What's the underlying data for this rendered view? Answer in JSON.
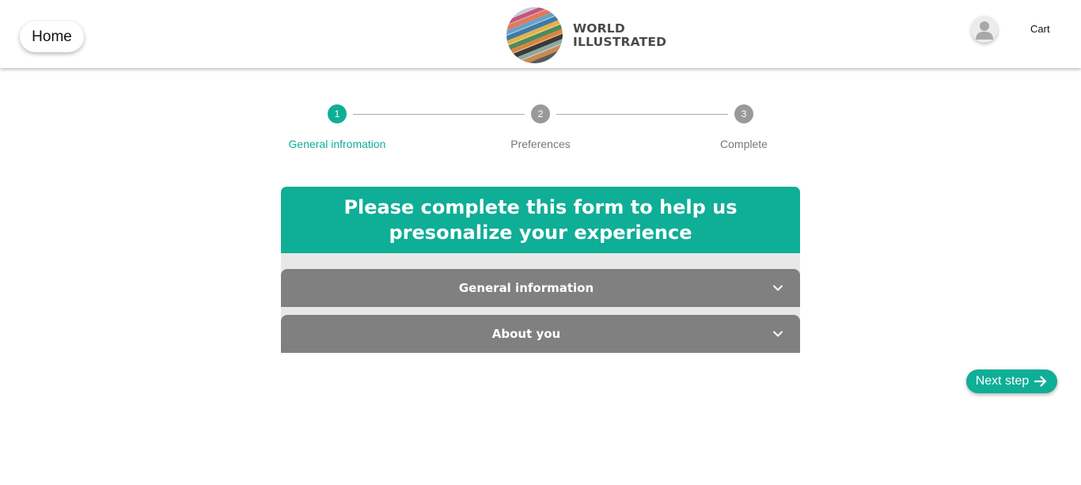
{
  "header": {
    "home_label": "Home",
    "logo_line1": "WORLD",
    "logo_line2": "ILLUSTRATED",
    "cart_label": "Cart"
  },
  "stepper": {
    "steps": [
      {
        "number": "1",
        "label": "General infromation",
        "active": true
      },
      {
        "number": "2",
        "label": "Preferences",
        "active": false
      },
      {
        "number": "3",
        "label": "Complete",
        "active": false
      }
    ]
  },
  "form": {
    "title": "Please complete this form to help us presonalize your experience",
    "sections": [
      {
        "label": "General information",
        "icon": "chevron-down-icon"
      },
      {
        "label": "About you",
        "icon": "chevron-down-icon"
      }
    ]
  },
  "actions": {
    "next_label": "Next step",
    "next_icon": "arrow-right-icon"
  },
  "colors": {
    "accent": "#0fae96",
    "inactive_step": "#999999",
    "accordion": "#808080"
  }
}
